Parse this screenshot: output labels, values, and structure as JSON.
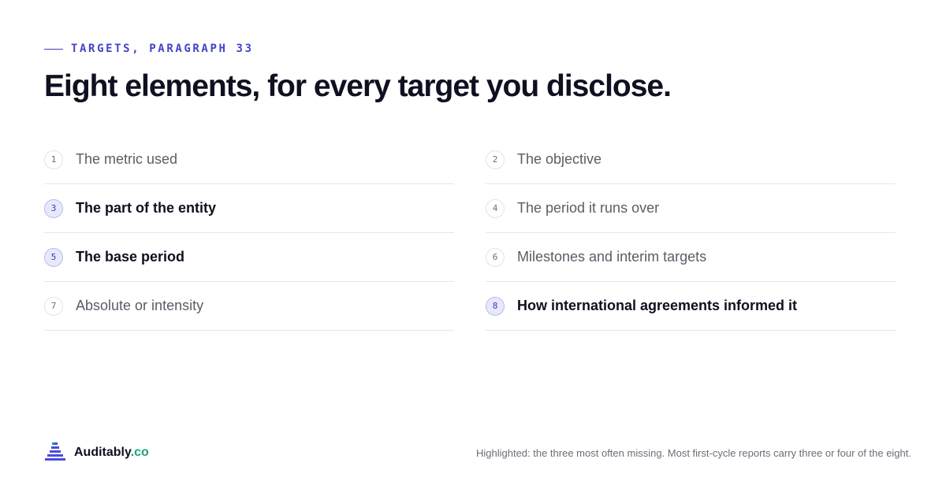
{
  "eyebrow": "TARGETS, PARAGRAPH 33",
  "title": "Eight elements, for every target you disclose.",
  "elements": [
    {
      "num": "1",
      "label": "The metric used",
      "highlighted": false
    },
    {
      "num": "2",
      "label": "The objective",
      "highlighted": false
    },
    {
      "num": "3",
      "label": "The part of the entity",
      "highlighted": true
    },
    {
      "num": "4",
      "label": "The period it runs over",
      "highlighted": false
    },
    {
      "num": "5",
      "label": "The base period",
      "highlighted": true
    },
    {
      "num": "6",
      "label": "Milestones and interim targets",
      "highlighted": false
    },
    {
      "num": "7",
      "label": "Absolute or intensity",
      "highlighted": false
    },
    {
      "num": "8",
      "label": "How international agreements informed it",
      "highlighted": true
    }
  ],
  "footer": {
    "brand_name": "Auditably",
    "brand_tld": ".co",
    "note": "Highlighted: the three most often missing. Most first-cycle reports carry three or four of the eight."
  },
  "colors": {
    "accent": "#4444c8",
    "highlight_fill": "#e8e8fb",
    "brand_green": "#1aa37a",
    "logo_blue": "#4b4be0"
  }
}
